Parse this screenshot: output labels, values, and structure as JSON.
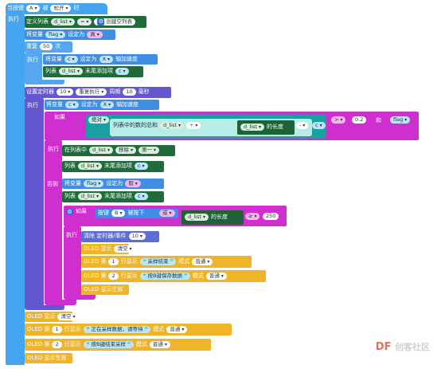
{
  "event": {
    "when": "当按键",
    "key": "A",
    "state_word": "被",
    "state": "松开",
    "time": "时",
    "exec": "执行"
  },
  "init": {
    "define_list": "定义列表",
    "list_name": "d_list",
    "eq": "=",
    "create_empty": "创建空列表",
    "set_var": "将变量",
    "var_flag": "flag",
    "set_to": "设定为",
    "val_false": "真"
  },
  "repeat": {
    "label": "重复",
    "count": "50",
    "times": "次",
    "exec": "执行",
    "set_var": "将变量",
    "var_c": "c",
    "set_to": "设定为",
    "x": "X",
    "accel": "轴加速度",
    "list": "列表",
    "list_name": "d_list",
    "append": "末尾添加项",
    "item": "c"
  },
  "timer": {
    "label": "设置定时器",
    "id": "10",
    "mode": "重复执行",
    "period": "周期",
    "ms_val": "10",
    "ms": "毫秒",
    "exec": "执行",
    "set_var": "将变量",
    "var_c": "c",
    "set_to": "设定为",
    "x": "X",
    "accel": "轴加速度"
  },
  "if1": {
    "if": "如果",
    "abs": "绝对",
    "sum_text": "列表中的数的总和",
    "list_name": "d_list",
    "div": "÷",
    "length_of": "的长度",
    "minus": "-",
    "c": "c",
    "gt": ">",
    "threshold": "0.2",
    "and": "和",
    "flag": "flag",
    "exec": "执行",
    "in_list": "在列表中",
    "remove": "移除",
    "first": "第一",
    "list": "列表",
    "append": "末尾添加项",
    "item": "c",
    "else": "否则",
    "set_var": "将变量",
    "var_flag": "flag",
    "set_to": "设定为",
    "val_fake": "假"
  },
  "if2": {
    "if": "如果",
    "button": "按键",
    "key": "B",
    "pressed": "被按下",
    "or": "或",
    "length_of": "的长度",
    "ge": "≥",
    "count": "250",
    "exec": "执行",
    "clear_timer": "清除 定时器/事件",
    "timer_id": "10",
    "oled_show": "OLED 显示",
    "clear": "清空",
    "oled_row": "OLED 第",
    "row1": "1",
    "row2": "2",
    "row_show": "行显示",
    "txt1": "采样结束",
    "txt2": "按B键保存数据",
    "mode": "模式",
    "normal": "普通",
    "effect": "OLED 显示生效"
  },
  "tail": {
    "oled_show": "OLED 显示",
    "clear": "清空",
    "oled_row": "OLED 第",
    "row1": "1",
    "row2": "2",
    "row_show": "行显示",
    "txt1": "正在采样数据，请等待",
    "txt2": "按B键结束采样",
    "mode": "模式",
    "normal": "普通",
    "effect": "OLED 显示生效"
  },
  "watermark": {
    "brand": "DF",
    "site": "创客社区"
  },
  "colors": {
    "event": "#45a5f0",
    "list": "#1f6b3a",
    "timer": "#6358d0",
    "if": "#cf2fcf",
    "oled": "#f0b429"
  }
}
